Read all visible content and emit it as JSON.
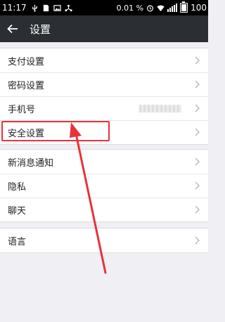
{
  "status_bar": {
    "time": "11:17",
    "battery_percent_text": "0.01 %",
    "battery_level_text": "100"
  },
  "header": {
    "title": "设置"
  },
  "groups": [
    {
      "items": [
        {
          "label": "支付设置"
        },
        {
          "label": "密码设置"
        },
        {
          "label": "手机号"
        },
        {
          "label": "安全设置"
        }
      ]
    },
    {
      "items": [
        {
          "label": "新消息通知"
        },
        {
          "label": "隐私"
        },
        {
          "label": "聊天"
        }
      ]
    },
    {
      "items": [
        {
          "label": "语言"
        }
      ]
    }
  ],
  "annotation": {
    "highlight_color": "#e8323a",
    "highlighted_item": "安全设置"
  },
  "colors": {
    "header_bg": "#2b2f33",
    "page_bg": "#efeff4",
    "accent_red": "#e8323a"
  }
}
